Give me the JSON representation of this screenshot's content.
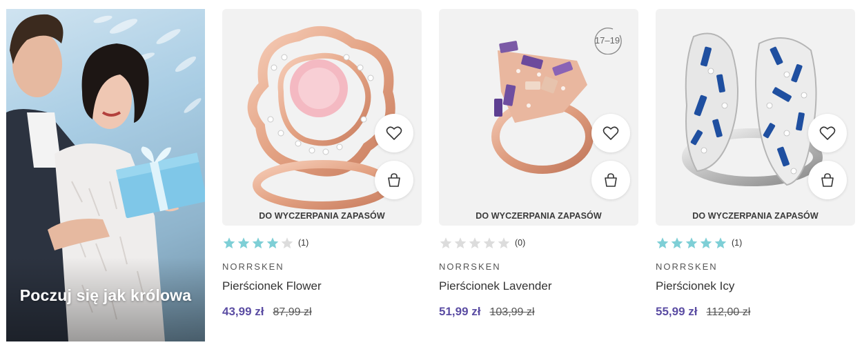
{
  "promo": {
    "title": "Poczuj się jak królowa"
  },
  "colors": {
    "accent_price": "#5b4da3",
    "star_filled": "#7ecfd6",
    "star_empty": "#dcdcdc",
    "card_bg": "#f2f2f2"
  },
  "products": [
    {
      "badge": "DO WYCZERPANIA ZAPASÓW",
      "rating": 4,
      "rating_count": "(1)",
      "brand": "NORRSKEN",
      "name": "Pierścionek Flower",
      "price": "43,99 zł",
      "old_price": "87,99 zł",
      "age_label": ""
    },
    {
      "badge": "DO WYCZERPANIA ZAPASÓW",
      "rating": 0,
      "rating_count": "(0)",
      "brand": "NORRSKEN",
      "name": "Pierścionek Lavender",
      "price": "51,99 zł",
      "old_price": "103,99 zł",
      "age_label": "17–19"
    },
    {
      "badge": "DO WYCZERPANIA ZAPASÓW",
      "rating": 5,
      "rating_count": "(1)",
      "brand": "NORRSKEN",
      "name": "Pierścionek Icy",
      "price": "55,99 zł",
      "old_price": "112,00 zł",
      "age_label": ""
    }
  ]
}
